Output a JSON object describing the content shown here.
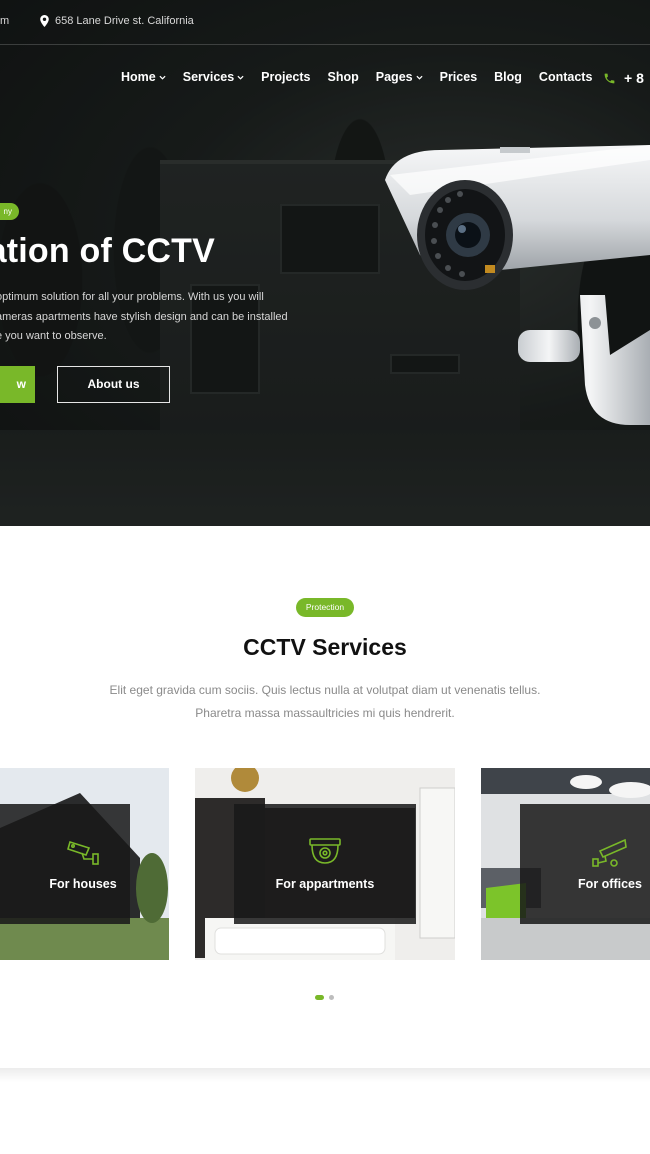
{
  "topbar": {
    "email_tail": "m",
    "address": "658 Lane Drive st. California"
  },
  "nav": {
    "items": [
      {
        "label": "Home",
        "has_dropdown": true
      },
      {
        "label": "Services",
        "has_dropdown": true
      },
      {
        "label": "Projects",
        "has_dropdown": false
      },
      {
        "label": "Shop",
        "has_dropdown": false
      },
      {
        "label": "Pages",
        "has_dropdown": true
      },
      {
        "label": "Prices",
        "has_dropdown": false
      },
      {
        "label": "Blog",
        "has_dropdown": false
      },
      {
        "label": "Contacts",
        "has_dropdown": false
      }
    ],
    "phone_partial": "+ 8"
  },
  "hero": {
    "badge": "ny",
    "title": "lation of CCTV",
    "text_lines": [
      "optimum solution for all your problems. With us you will",
      "ameras apartments have stylish design and can be installed",
      "e you want to observe."
    ],
    "primary_button": "w",
    "secondary_button": "About us"
  },
  "services": {
    "badge": "Protection",
    "title": "CCTV Services",
    "subtitle_lines": [
      "Elit eget gravida cum sociis. Quis lectus nulla at volutpat diam ut venenatis tellus.",
      "Pharetra massa massaultricies mi quis hendrerit."
    ],
    "cards": [
      {
        "label": "For houses",
        "icon": "security-camera-icon"
      },
      {
        "label": "For appartments",
        "icon": "dome-camera-icon"
      },
      {
        "label": "For offices",
        "icon": "cctv-camera-icon"
      }
    ]
  },
  "colors": {
    "accent": "#79b829",
    "hero_dark": "#1f2321",
    "card_overlay": "#181818"
  }
}
